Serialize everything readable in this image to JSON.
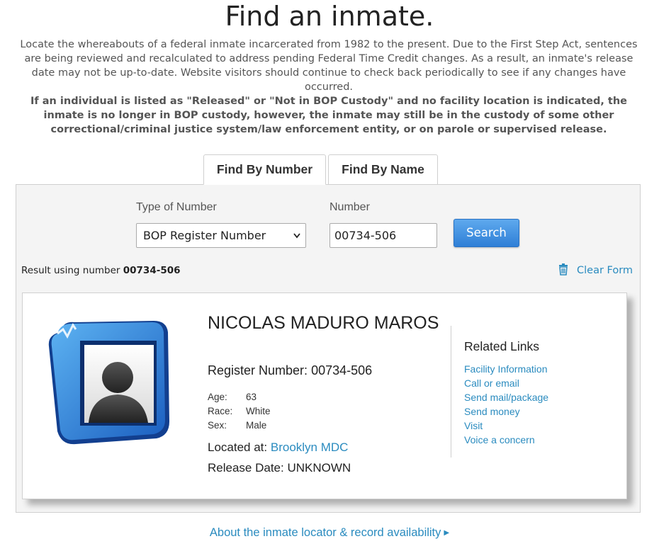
{
  "page": {
    "title": "Find an inmate.",
    "intro": "Locate the whereabouts of a federal inmate incarcerated from 1982 to the present. Due to the First Step Act, sentences are being reviewed and recalculated to address pending Federal Time Credit changes. As a result, an inmate's release date may not be up-to-date. Website visitors should continue to check back periodically to see if any changes have occurred.",
    "notice": "If an individual is listed as \"Released\" or \"Not in BOP Custody\" and no facility location is indicated, the inmate is no longer in BOP custody, however, the inmate may still be in the custody of some other correctional/criminal justice system/law enforcement entity, or on parole or supervised release."
  },
  "tabs": [
    {
      "label": "Find By Number",
      "active": true
    },
    {
      "label": "Find By Name",
      "active": false
    }
  ],
  "form": {
    "type_label": "Type of Number",
    "type_value": "BOP Register Number",
    "number_label": "Number",
    "number_value": "00734-506",
    "search_label": "Search"
  },
  "result": {
    "prefix": "Result using number",
    "number": "00734-506",
    "clear_label": "Clear Form"
  },
  "inmate": {
    "name": "NICOLAS MADURO MAROS",
    "register_label": "Register Number:",
    "register_number": "00734-506",
    "age_label": "Age:",
    "age": "63",
    "race_label": "Race:",
    "race": "White",
    "sex_label": "Sex:",
    "sex": "Male",
    "located_label": "Located at:",
    "location": "Brooklyn MDC",
    "release_label": "Release Date:",
    "release_date": "UNKNOWN"
  },
  "related": {
    "heading": "Related Links",
    "links": [
      "Facility Information",
      "Call or email",
      "Send mail/package",
      "Send money",
      "Visit",
      "Voice a concern"
    ]
  },
  "footer": {
    "about_link": "About the inmate locator & record availability"
  },
  "colors": {
    "link": "#2a8bbf",
    "button": "#2f7fd6",
    "panel": "#f4f4f4"
  },
  "icons": [
    "trash-icon",
    "select-chevron-icon",
    "caret-right-icon",
    "avatar-placeholder-icon"
  ]
}
